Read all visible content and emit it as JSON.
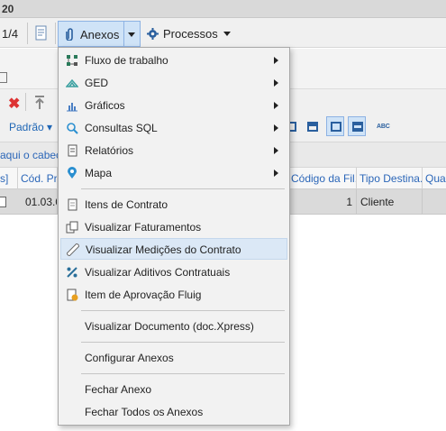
{
  "window": {
    "title_fragment": "20"
  },
  "toolbar": {
    "page_indicator": "1/4",
    "anexos_label": "Anexos",
    "processos_label": "Processos"
  },
  "edit_toolbar": {
    "layout_label": "Padrão ▾"
  },
  "group_hint": "aqui o cabeça",
  "grid": {
    "columns": [
      {
        "label": "s]"
      },
      {
        "label": "Cód. Pro"
      },
      {
        "label": "Código da Fil..."
      },
      {
        "label": "Tipo Destina..."
      },
      {
        "label": "Quan"
      }
    ],
    "row": {
      "cod_produto": "01.03.0",
      "codigo_filial": "1",
      "tipo_destinatario": "Cliente"
    }
  },
  "menu": {
    "items": [
      {
        "label": "Fluxo de trabalho",
        "icon": "workflow-icon",
        "submenu": true
      },
      {
        "label": "GED",
        "icon": "ged-icon",
        "submenu": true
      },
      {
        "label": "Gráficos",
        "icon": "chart-icon",
        "submenu": true
      },
      {
        "label": "Consultas SQL",
        "icon": "search-icon",
        "submenu": true
      },
      {
        "label": "Relatórios",
        "icon": "report-icon",
        "submenu": true
      },
      {
        "label": "Mapa",
        "icon": "map-pin-icon",
        "submenu": true
      },
      {
        "label": "Itens de Contrato",
        "icon": "document-icon",
        "submenu": false
      },
      {
        "label": "Visualizar Faturamentos",
        "icon": "copy-icon",
        "submenu": false
      },
      {
        "label": "Visualizar Medições do Contrato",
        "icon": "ruler-icon",
        "submenu": false,
        "highlighted": true
      },
      {
        "label": "Visualizar Aditivos Contratuais",
        "icon": "percent-icon",
        "submenu": false
      },
      {
        "label": "Item de Aprovação Fluig",
        "icon": "approval-icon",
        "submenu": false
      },
      {
        "label": "Visualizar Documento (doc.Xpress)",
        "icon": "",
        "submenu": false
      },
      {
        "label": "Configurar Anexos",
        "icon": "",
        "submenu": false
      },
      {
        "label": "Fechar Anexo",
        "icon": "",
        "submenu": false
      },
      {
        "label": "Fechar Todos os Anexos",
        "icon": "",
        "submenu": false
      }
    ]
  },
  "colors": {
    "accent_blue": "#2b66b8",
    "highlight": "#dbe8f6",
    "delete_red": "#d33333"
  }
}
